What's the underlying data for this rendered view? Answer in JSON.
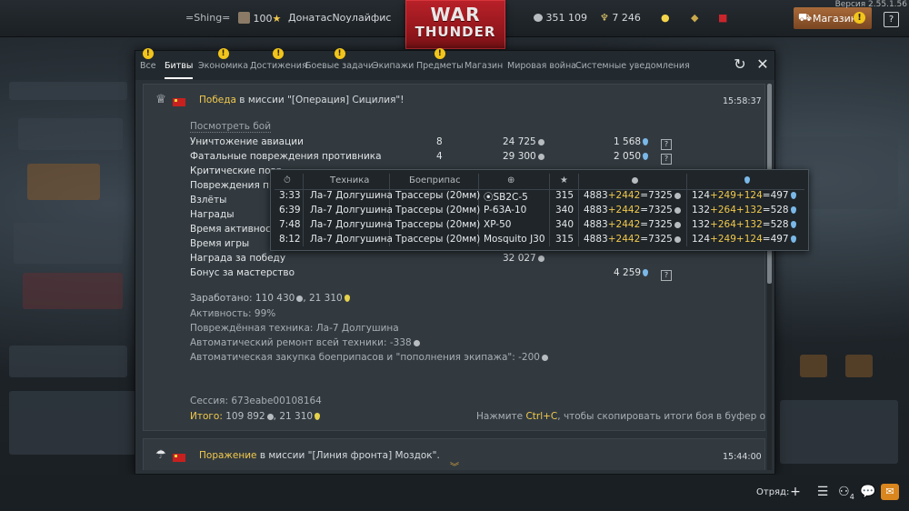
{
  "topbar": {
    "username": "=Shing=",
    "level": "100",
    "squad_name": "ДонатасNoyлайфис",
    "silver_lions": "351 109",
    "golden_eagles": "7 246",
    "shop_label": "Магазин",
    "version": "Версия 2.55.1.56",
    "logo_line1": "WAR",
    "logo_line2": "THUNDER"
  },
  "tabs": [
    {
      "label": "Все",
      "badge": "!"
    },
    {
      "label": "Битвы",
      "badge": ""
    },
    {
      "label": "Экономика",
      "badge": "!"
    },
    {
      "label": "Достижения",
      "badge": "!"
    },
    {
      "label": "Боевые задачи",
      "badge": "!"
    },
    {
      "label": "Экипажи",
      "badge": ""
    },
    {
      "label": "Предметы",
      "badge": "!"
    },
    {
      "label": "Магазин",
      "badge": ""
    },
    {
      "label": "Мировая война",
      "badge": ""
    },
    {
      "label": "Системные уведомления",
      "badge": ""
    }
  ],
  "entry1": {
    "result": "Победа",
    "mission_text": " в миссии \"[Операция] Сицилия\"!",
    "time": "15:58:37",
    "view_battle": "Посмотреть бой",
    "rows": [
      {
        "label": "Уничтожение авиации",
        "count": "8",
        "lions": "24 725",
        "rp": "1 568"
      },
      {
        "label": "Фатальные повреждения противника",
        "count": "4",
        "lions": "29 300",
        "rp": "2 050"
      },
      {
        "label": "Критические повр",
        "count": "",
        "lions": "",
        "rp": ""
      },
      {
        "label": "Повреждения про",
        "count": "",
        "lions": "",
        "rp": ""
      },
      {
        "label": "Взлёты",
        "count": "",
        "lions": "",
        "rp": ""
      },
      {
        "label": "Награды",
        "count": "",
        "lions": "",
        "rp": ""
      },
      {
        "label": "Время активности",
        "count": "",
        "lions": "",
        "rp": ""
      },
      {
        "label": "Время игры",
        "count": "",
        "lions": "",
        "rp": ""
      },
      {
        "label": "Награда за победу",
        "count": "",
        "lions": "32 027",
        "rp": ""
      },
      {
        "label": "Бонус за мастерство",
        "count": "",
        "lions": "",
        "rp": "4 259"
      }
    ],
    "earned_label": "Заработано: ",
    "earned_lions": "110 430",
    "earned_rp": ", 21 310",
    "activity": "Активность: 99%",
    "damaged": "Повреждённая техника: Ла-7 Долгушина",
    "repair": "Автоматический ремонт всей техники: -338",
    "restock": "Автоматическая закупка боеприпасов и \"пополнения экипажа\": -200",
    "session": "Сессия: 673eabe00108164",
    "total_label": "Итого:",
    "total_lions": " 109 892",
    "total_rp": ", 21 310",
    "copy_hint_pre": "Нажмите ",
    "copy_hint_key": "Ctrl+C",
    "copy_hint_post": ", чтобы скопировать итоги боя в буфер обмена"
  },
  "entry2": {
    "result": "Поражение",
    "mission_text": " в миссии \"[Линия фронта] Моздок\".",
    "time": "15:44:00"
  },
  "tooltip": {
    "headers": {
      "vehicle": "Техника",
      "ammo": "Боеприпас"
    },
    "rows": [
      {
        "time": "3:33",
        "vehicle": "Ла-7 Долгушина",
        "ammo": "Трассеры (20мм)",
        "target": "SB2C-5",
        "score": "315",
        "l1": "4883",
        "l2": "2442",
        "l3": "=7325",
        "r1": "124",
        "r2": "249",
        "r3": "124",
        "r4": "=497"
      },
      {
        "time": "6:39",
        "vehicle": "Ла-7 Долгушина",
        "ammo": "Трассеры (20мм)",
        "target": "P-63A-10",
        "score": "340",
        "l1": "4883",
        "l2": "2442",
        "l3": "=7325",
        "r1": "132",
        "r2": "264",
        "r3": "132",
        "r4": "=528"
      },
      {
        "time": "7:48",
        "vehicle": "Ла-7 Долгушина",
        "ammo": "Трассеры (20мм)",
        "target": "XP-50",
        "score": "340",
        "l1": "4883",
        "l2": "2442",
        "l3": "=7325",
        "r1": "132",
        "r2": "264",
        "r3": "132",
        "r4": "=528"
      },
      {
        "time": "8:12",
        "vehicle": "Ла-7 Долгушина",
        "ammo": "Трассеры (20мм)",
        "target": "Mosquito J30",
        "score": "315",
        "l1": "4883",
        "l2": "2442",
        "l3": "=7325",
        "r1": "124",
        "r2": "249",
        "r3": "124",
        "r4": "=497"
      }
    ]
  },
  "bottombar": {
    "squad_label": "Отряд:",
    "friends_count": "4"
  }
}
